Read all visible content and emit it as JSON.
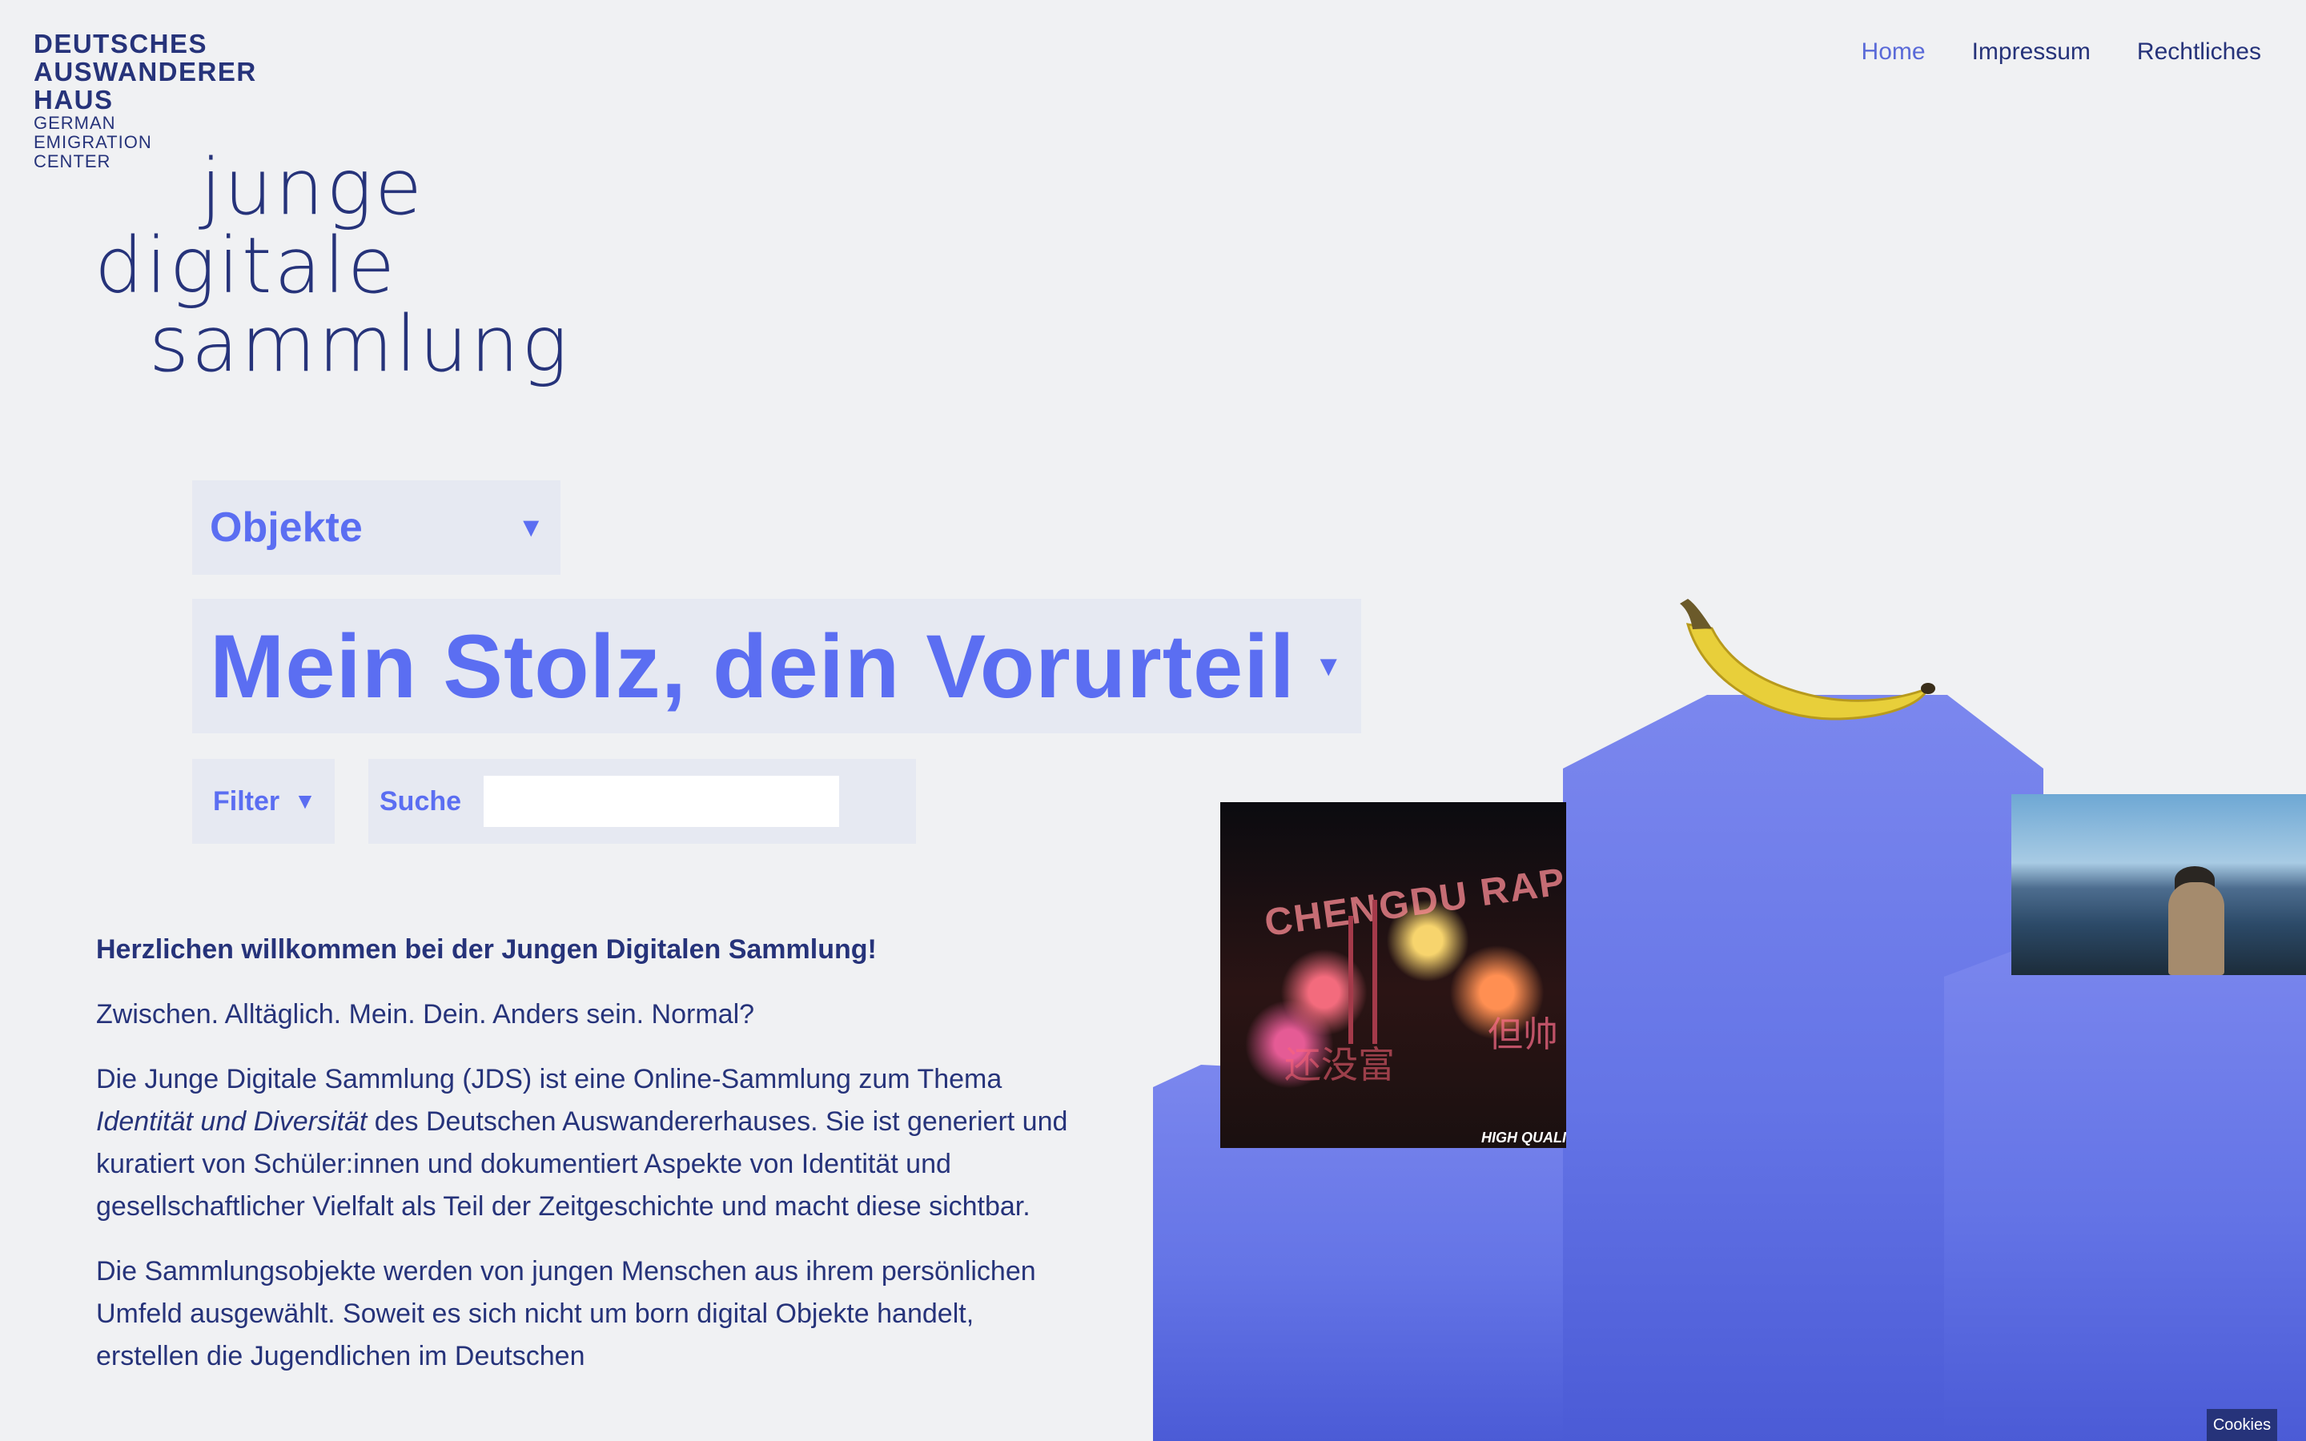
{
  "logo": {
    "line1": "DEUTSCHES",
    "line2": "AUSWANDERER",
    "line3": "HAUS",
    "sub1": "GERMAN",
    "sub2": "EMIGRATION",
    "sub3": "CENTER"
  },
  "nav": {
    "items": [
      {
        "label": "Home"
      },
      {
        "label": "Impressum"
      },
      {
        "label": "Rechtliches"
      }
    ]
  },
  "jds_logo": {
    "word1": "junge",
    "word2": "digitale",
    "word3": "sammlung"
  },
  "selectors": {
    "type_label": "Objekte",
    "title_label": "Mein Stolz, dein Vorurteil",
    "caret": "▼"
  },
  "search": {
    "filter_label": "Filter",
    "search_label": "Suche",
    "placeholder": ""
  },
  "intro": {
    "lead": "Herzlichen willkommen bei der Jungen Digitalen Sammlung!",
    "line2": "Zwischen. Alltäglich. Mein. Dein. Anders sein. Normal?",
    "p3_before": "Die Junge Digitale Sammlung (JDS) ist eine Online-Sammlung zum Thema ",
    "p3_italic": "Identität und Diversität",
    "p3_after": " des Deutschen Auswandererhauses. Sie ist generiert und kuratiert von Schüler:innen und dokumentiert Aspekte von Identität und gesellschaftlicher Vielfalt als Teil der Zeitgeschichte und macht diese sichtbar.",
    "p4": "Die Sammlungsobjekte werden von jungen Menschen aus ihrem persönlichen Umfeld ausgewählt. Soweit es sich nicht um born digital Objekte handelt, erstellen die Jugendlichen im Deutschen"
  },
  "artwork": {
    "fireworks_title": "CHENGDU RAP",
    "fireworks_sub": "还没富",
    "fireworks_side": "但帅",
    "fireworks_tag": "HIGH QUALI"
  },
  "cookies": {
    "label": "Cookies"
  },
  "colors": {
    "background": "#f0f1f3",
    "navy": "#26337a",
    "accent": "#5b6ef2",
    "panel": "#e6e9f2",
    "podium": "#6474e6"
  }
}
